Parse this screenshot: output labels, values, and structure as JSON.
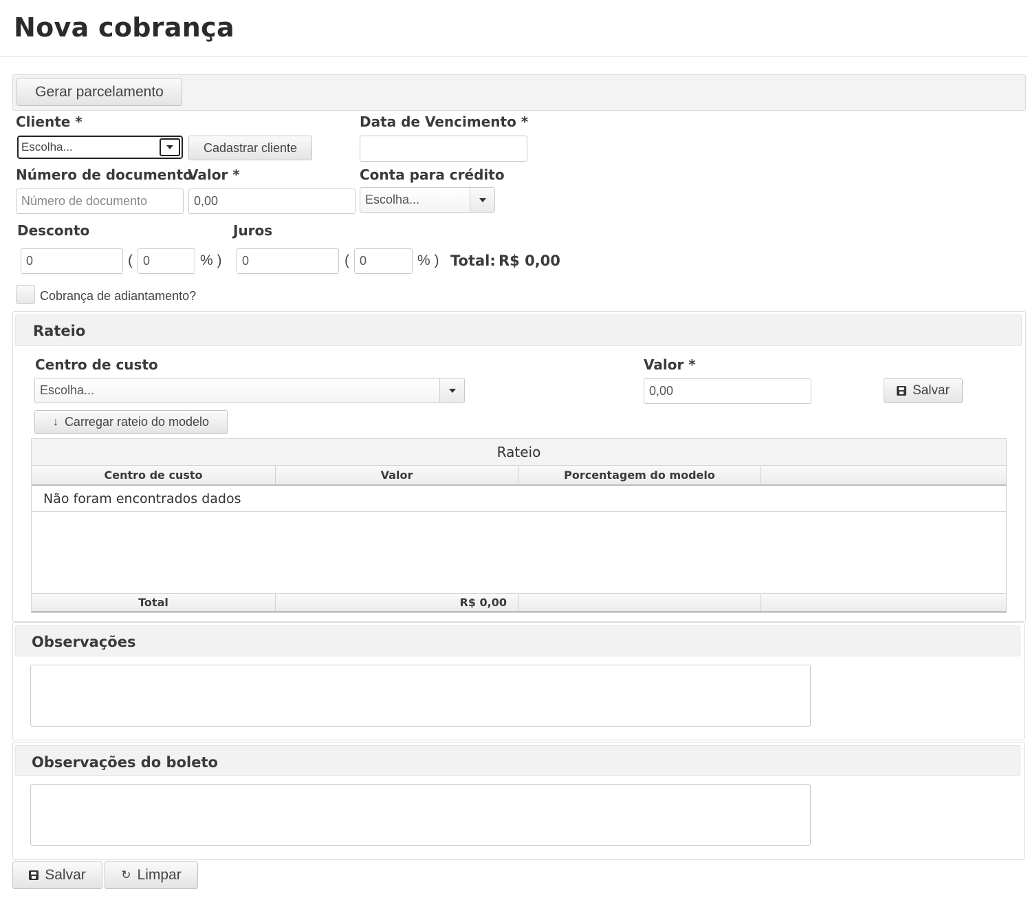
{
  "page": {
    "title": "Nova cobrança"
  },
  "toolbar": {
    "generate_installments_label": "Gerar parcelamento"
  },
  "form": {
    "cliente": {
      "label": "Cliente *",
      "value": "Escolha...",
      "register_label": "Cadastrar cliente"
    },
    "vencimento": {
      "label": "Data de Vencimento *",
      "value": ""
    },
    "numero_documento": {
      "label": "Número de documento",
      "placeholder": "Número de documento"
    },
    "valor": {
      "label": "Valor *",
      "value": "0,00"
    },
    "conta_credito": {
      "label": "Conta para crédito",
      "value": "Escolha..."
    },
    "desconto": {
      "label": "Desconto",
      "value": "0",
      "percent": "0"
    },
    "juros": {
      "label": "Juros",
      "value": "0",
      "percent": "0"
    },
    "paren_open": "(",
    "paren_close": "% )",
    "total_label": "Total:",
    "total_value": "R$ 0,00",
    "adiantamento": {
      "label": "Cobrança de adiantamento?",
      "checked": false
    }
  },
  "rateio": {
    "panel_title": "Rateio",
    "centro_custo": {
      "label": "Centro de custo",
      "value": "Escolha..."
    },
    "valor": {
      "label": "Valor *",
      "value": "0,00"
    },
    "save_label": "Salvar",
    "load_model_label": "Carregar rateio do modelo",
    "table": {
      "caption": "Rateio",
      "columns": [
        "Centro de custo",
        "Valor",
        "Porcentagem do modelo",
        ""
      ],
      "empty_message": "Não foram encontrados dados",
      "footer": {
        "label": "Total",
        "value": "R$ 0,00"
      }
    }
  },
  "observacoes": {
    "title": "Observações",
    "value": ""
  },
  "observacoes_boleto": {
    "title": "Observações do boleto",
    "value": ""
  },
  "actions": {
    "save_label": "Salvar",
    "clear_label": "Limpar"
  },
  "icons": {
    "save": "floppy-disk-icon",
    "clear": "refresh-icon",
    "download": "arrow-down-icon",
    "dropdown": "caret-down-icon"
  }
}
